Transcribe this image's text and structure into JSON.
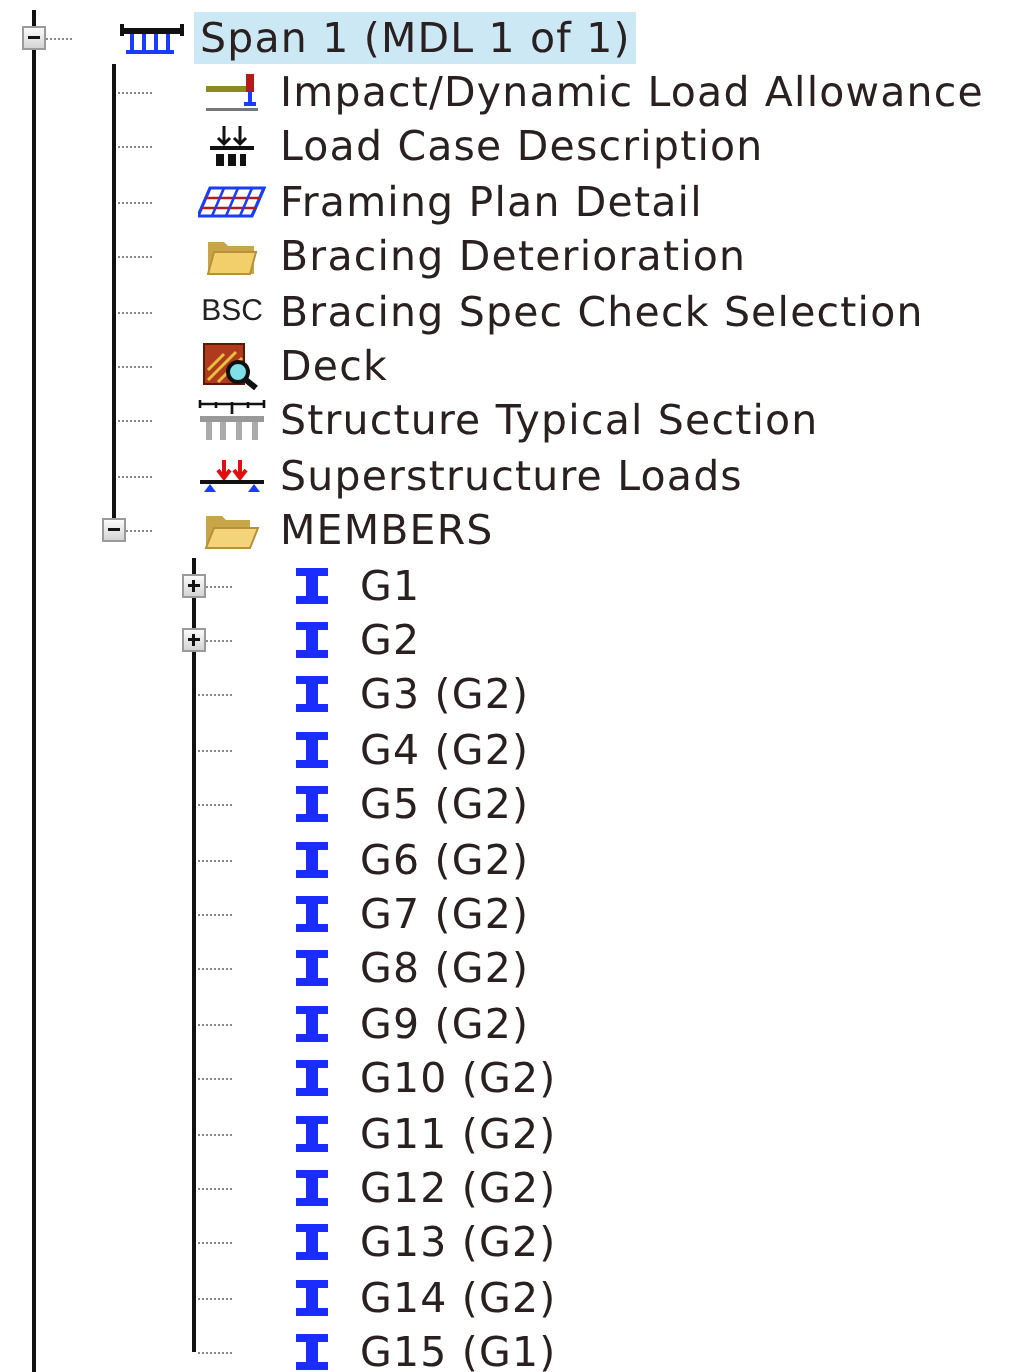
{
  "tree": [
    {
      "label": "Span 1 (MDL 1 of 1)",
      "kind": "bridge",
      "selected": true,
      "expanded": true,
      "children": [
        {
          "label": "Impact/Dynamic Load Allowance",
          "kind": "impact",
          "selected": false
        },
        {
          "label": "Load Case Description",
          "kind": "load-case",
          "selected": false
        },
        {
          "label": "Framing Plan Detail",
          "kind": "framing",
          "selected": false
        },
        {
          "label": "Bracing Deterioration",
          "kind": "folder",
          "selected": false
        },
        {
          "label": "Bracing Spec Check Selection",
          "kind": "text",
          "icon_text": "BSC",
          "selected": false
        },
        {
          "label": "Deck",
          "kind": "deck",
          "selected": false
        },
        {
          "label": "Structure Typical Section",
          "kind": "section",
          "selected": false
        },
        {
          "label": "Superstructure Loads",
          "kind": "loads",
          "selected": false
        },
        {
          "label": "MEMBERS",
          "kind": "folder-open",
          "selected": false,
          "expanded": true,
          "children": [
            {
              "label": "G1",
              "kind": "girder",
              "selected": false,
              "expanded": false
            },
            {
              "label": "G2",
              "kind": "girder",
              "selected": false,
              "expanded": false
            },
            {
              "label": "G3 (G2)",
              "kind": "girder",
              "selected": false
            },
            {
              "label": "G4 (G2)",
              "kind": "girder",
              "selected": false
            },
            {
              "label": "G5 (G2)",
              "kind": "girder",
              "selected": false
            },
            {
              "label": "G6 (G2)",
              "kind": "girder",
              "selected": false
            },
            {
              "label": "G7 (G2)",
              "kind": "girder",
              "selected": false
            },
            {
              "label": "G8 (G2)",
              "kind": "girder",
              "selected": false
            },
            {
              "label": "G9 (G2)",
              "kind": "girder",
              "selected": false
            },
            {
              "label": "G10 (G2)",
              "kind": "girder",
              "selected": false
            },
            {
              "label": "G11 (G2)",
              "kind": "girder",
              "selected": false
            },
            {
              "label": "G12 (G2)",
              "kind": "girder",
              "selected": false
            },
            {
              "label": "G13 (G2)",
              "kind": "girder",
              "selected": false
            },
            {
              "label": "G14 (G2)",
              "kind": "girder",
              "selected": false
            },
            {
              "label": "G15 (G1)",
              "kind": "girder",
              "selected": false
            }
          ]
        }
      ]
    }
  ]
}
